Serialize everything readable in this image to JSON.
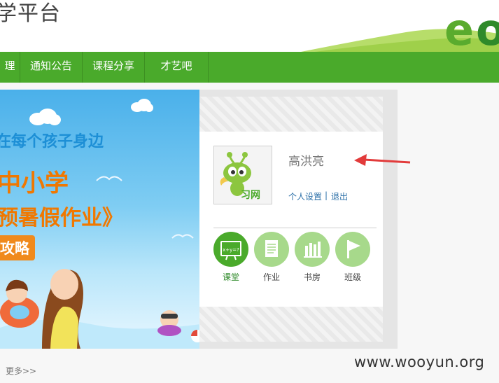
{
  "header": {
    "site_title": "学平台"
  },
  "nav": {
    "items": [
      "理",
      "通知公告",
      "课程分享",
      "才艺吧"
    ]
  },
  "banner": {
    "line1": "在每个孩子身边",
    "line2": "中小学",
    "line3": "预暑假作业》",
    "button": "攻略"
  },
  "more_link": "更多>>",
  "profile": {
    "avatar_text": "习网",
    "username": "高洪亮",
    "settings": "个人设置",
    "separator": "|",
    "logout": "退出"
  },
  "shortcuts": [
    {
      "label": "课堂",
      "icon": "formula-board-icon",
      "color": "#4aaa2b",
      "active": true
    },
    {
      "label": "作业",
      "icon": "document-icon",
      "color": "#a7d98b",
      "active": false
    },
    {
      "label": "书房",
      "icon": "bookshelf-icon",
      "color": "#a7d98b",
      "active": false
    },
    {
      "label": "班级",
      "icon": "flag-icon",
      "color": "#a7d98b",
      "active": false
    }
  ],
  "formula_icon_text": "x+y=?",
  "watermark": "www.wooyun.org"
}
